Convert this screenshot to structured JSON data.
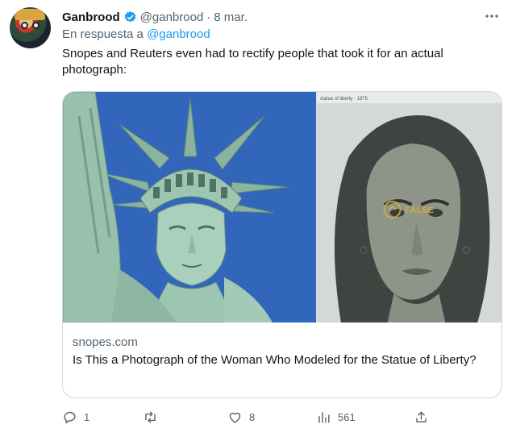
{
  "tweet": {
    "author_name": "Ganbrood",
    "handle": "@ganbrood",
    "separator": "·",
    "date": "8 mar.",
    "reply_prefix": "En respuesta a",
    "reply_to": "@ganbrood",
    "text": "Snopes and Reuters even had to rectify people that took it for an actual photograph:"
  },
  "card": {
    "domain": "snopes.com",
    "title": "Is This a Photograph of the Woman Who Modeled for the Statue of Liberty?",
    "image_caption": "statue of liberty - 1875",
    "watermark": "FALSE"
  },
  "actions": {
    "replies": "1",
    "retweets": "",
    "likes": "8",
    "views": "561"
  },
  "colors": {
    "accent": "#1d9bf0",
    "muted": "#536471",
    "border": "#cfd9de",
    "sky": "#2f62b6",
    "statue": "#8fb5a3"
  },
  "icons": [
    "verified-badge-icon",
    "more-icon",
    "reply-icon",
    "retweet-icon",
    "like-icon",
    "views-icon",
    "share-icon"
  ]
}
